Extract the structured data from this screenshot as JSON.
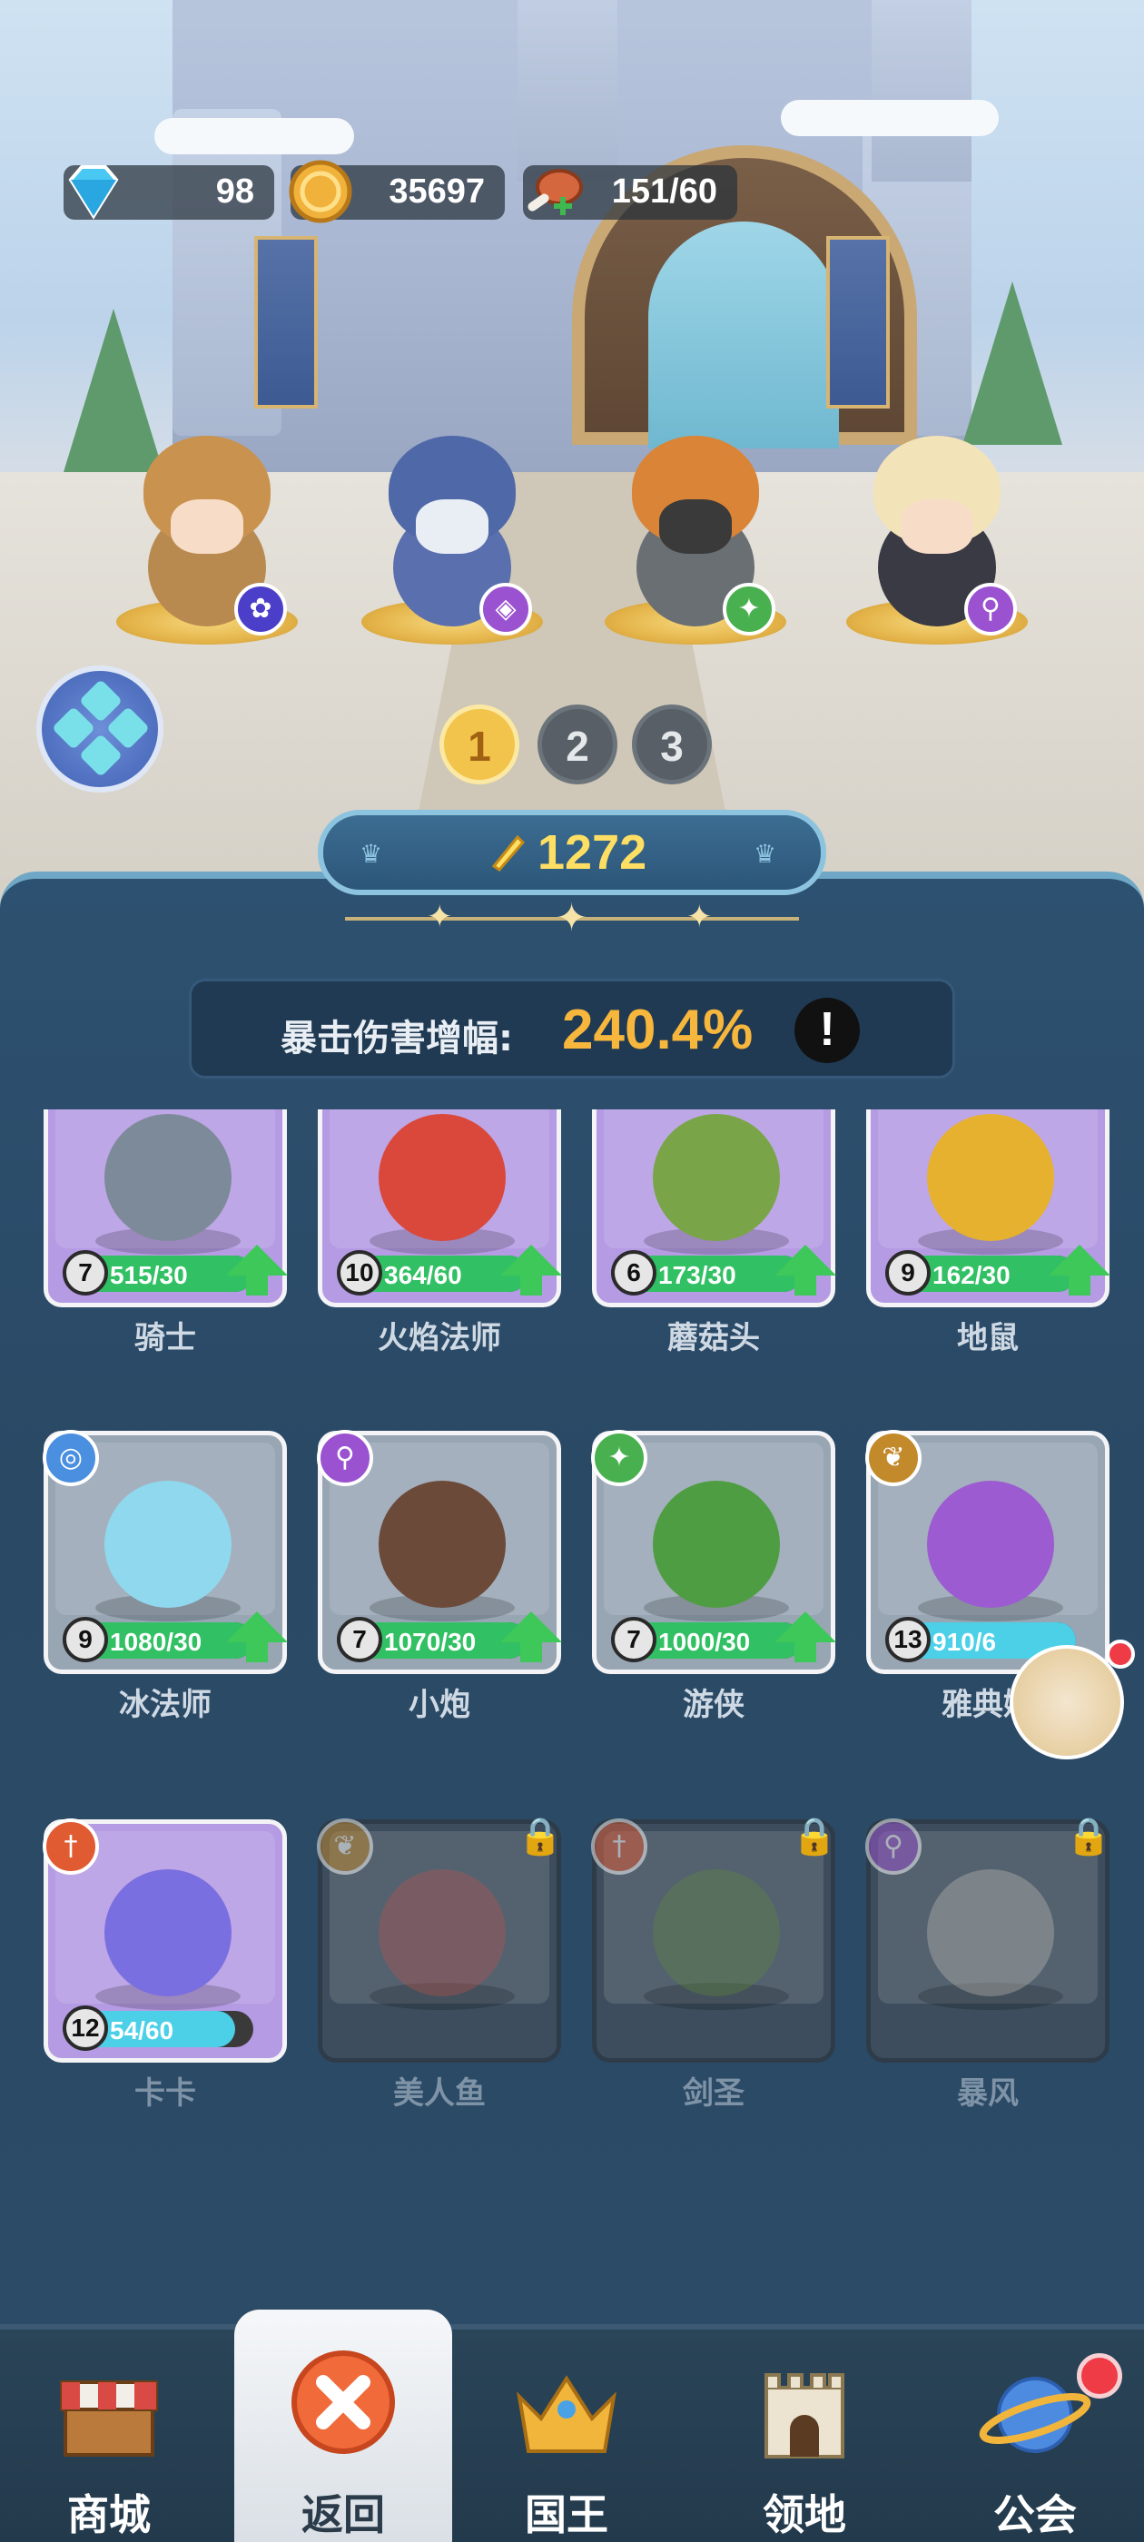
{
  "resources": {
    "gems": "98",
    "coins": "35697",
    "food": "151/60"
  },
  "team": [
    {
      "badge_icon": "paw-icon"
    },
    {
      "badge_icon": "eye-icon"
    },
    {
      "badge_icon": "target-icon"
    },
    {
      "badge_icon": "staff-icon"
    }
  ],
  "team_pages": [
    "1",
    "2",
    "3"
  ],
  "power": "1272",
  "bonus": {
    "label": "暴击伤害增幅:",
    "value": "240.4%",
    "info": "!"
  },
  "cards": [
    {
      "name": "骑士",
      "level": "7",
      "progress": "515/30",
      "fill": 1.0,
      "upgrade": true,
      "style": "purple",
      "type_icon": ""
    },
    {
      "name": "火焰法师",
      "level": "10",
      "progress": "364/60",
      "fill": 1.0,
      "upgrade": true,
      "style": "purple",
      "type_icon": ""
    },
    {
      "name": "蘑菇头",
      "level": "6",
      "progress": "173/30",
      "fill": 1.0,
      "upgrade": true,
      "style": "purple",
      "type_icon": ""
    },
    {
      "name": "地鼠",
      "level": "9",
      "progress": "162/30",
      "fill": 1.0,
      "upgrade": true,
      "style": "purple",
      "type_icon": ""
    },
    {
      "name": "冰法师",
      "level": "9",
      "progress": "1080/30",
      "fill": 1.0,
      "upgrade": true,
      "style": "gray",
      "type_icon": "swirl-icon"
    },
    {
      "name": "小炮",
      "level": "7",
      "progress": "1070/30",
      "fill": 1.0,
      "upgrade": true,
      "style": "gray",
      "type_icon": "staff-icon"
    },
    {
      "name": "游侠",
      "level": "7",
      "progress": "1000/30",
      "fill": 1.0,
      "upgrade": true,
      "style": "gray",
      "type_icon": "target-icon"
    },
    {
      "name": "雅典娜",
      "level": "13",
      "progress": "910/6",
      "fill": 1.0,
      "upgrade": false,
      "style": "gray",
      "type_icon": "wing-icon"
    },
    {
      "name": "卡卡",
      "level": "12",
      "progress": "54/60",
      "fill": 0.9,
      "upgrade": false,
      "style": "purple",
      "type_icon": "sword-icon"
    },
    {
      "name": "美人鱼",
      "level": "",
      "progress": "",
      "fill": 0,
      "upgrade": false,
      "style": "locked",
      "type_icon": "wing-icon"
    },
    {
      "name": "剑圣",
      "level": "",
      "progress": "",
      "fill": 0,
      "upgrade": false,
      "style": "locked",
      "type_icon": "sword-icon"
    },
    {
      "name": "暴风",
      "level": "",
      "progress": "",
      "fill": 0,
      "upgrade": false,
      "style": "locked",
      "type_icon": "staff-icon"
    }
  ],
  "nav": [
    {
      "label": "商城",
      "icon": "shop-icon"
    },
    {
      "label": "返回",
      "icon": "close-icon"
    },
    {
      "label": "国王",
      "icon": "crown-icon"
    },
    {
      "label": "领地",
      "icon": "castle-icon"
    },
    {
      "label": "公会",
      "icon": "planet-icon"
    }
  ],
  "colors": {
    "accent_gold": "#f7b63c",
    "power_yellow": "#ffdf63",
    "panel_blue": "#2d5170",
    "progress_green": "#31c063",
    "notification_red": "#ee3b46"
  }
}
